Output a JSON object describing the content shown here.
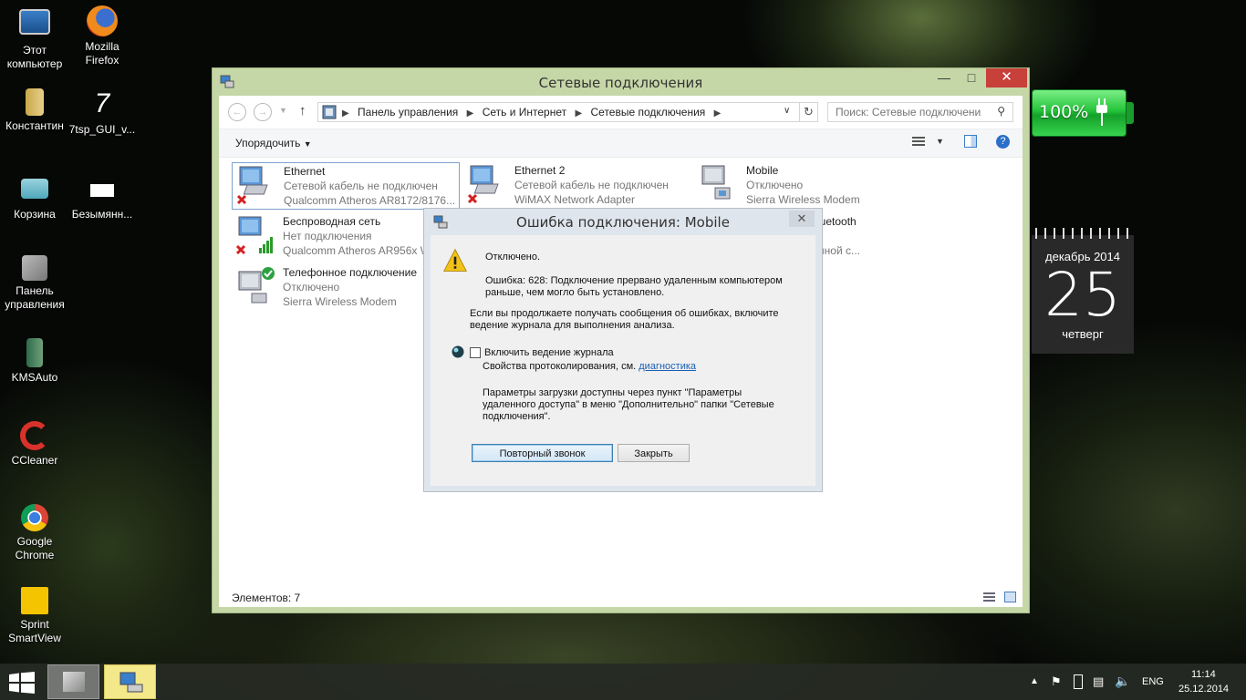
{
  "desktop": {
    "icons": [
      {
        "label": "Этот\nкомпьютер",
        "icon": "computer-icon"
      },
      {
        "label": "Mozilla\nFirefox",
        "icon": "firefox-icon"
      },
      {
        "label": "Константин",
        "icon": "user-folder-icon"
      },
      {
        "label": "7tsp_GUI_v...",
        "icon": "7tsp-icon"
      },
      {
        "label": "Корзина",
        "icon": "recycle-bin-icon"
      },
      {
        "label": "Безымянн...",
        "icon": "image-file-icon"
      },
      {
        "label": "Панель\nуправления",
        "icon": "control-panel-icon"
      },
      {
        "label": "KMSAuto",
        "icon": "kmsauto-icon"
      },
      {
        "label": "CCleaner",
        "icon": "ccleaner-icon"
      },
      {
        "label": "Google\nChrome",
        "icon": "chrome-icon"
      },
      {
        "label": "Sprint\nSmartView",
        "icon": "sprint-icon"
      }
    ]
  },
  "battery_widget": {
    "percent": "100%",
    "level": 1.0,
    "color": "#25c43a"
  },
  "calendar_widget": {
    "month": "декабрь 2014",
    "day": "25",
    "weekday": "четверг"
  },
  "window": {
    "title": "Сетевые подключения",
    "buttons": {
      "minimize": "—",
      "maximize": "□",
      "close": "✕"
    },
    "address": {
      "crumbs": [
        "Панель управления",
        "Сеть и Интернет",
        "Сетевые подключения"
      ]
    },
    "search_placeholder": "Поиск: Сетевые подключения",
    "organize_label": "Упорядочить",
    "items": [
      {
        "name": "Ethernet",
        "status": "Сетевой кабель не подключен",
        "device": "Qualcomm Atheros AR8172/8176...",
        "badge": "red-x",
        "selected": true
      },
      {
        "name": "Ethernet 2",
        "status": "Сетевой кабель не подключен",
        "device": "WiMAX Network Adapter",
        "badge": "red-x",
        "selected": false
      },
      {
        "name": "Mobile",
        "status": "Отключено",
        "device": "Sierra Wireless Modem",
        "badge": "none",
        "selected": false
      },
      {
        "name": "Беспроводная сеть",
        "status": "Нет подключения",
        "device": "Qualcomm Atheros AR956x W",
        "badge": "red-x",
        "selected": false
      },
      {
        "name": "ючение Bluetooth",
        "status": "ия",
        "device": "etooth (личной с...",
        "badge": "none",
        "selected": false
      },
      {
        "name": "Телефонное подключение",
        "status": "Отключено",
        "device": "Sierra Wireless Modem",
        "badge": "green-check",
        "selected": false
      }
    ],
    "status_count": "Элементов: 7"
  },
  "dialog": {
    "title": "Ошибка подключения: Mobile",
    "close": "✕",
    "line_state": "Отключено.",
    "line_error_1": "Ошибка: 628: Подключение прервано удаленным компьютером",
    "line_error_2": "раньше, чем могло быть установлено.",
    "line_advice_1": "Если вы продолжаете получать сообщения об ошибках, включите",
    "line_advice_2": "ведение журнала для выполнения анализа.",
    "checkbox_label": "Включить ведение журнала",
    "checkbox_checked": false,
    "log_props": "Свойства протоколирования, см.",
    "log_link": "диагностика",
    "params_1": "Параметры загрузки доступны через пункт \"Параметры",
    "params_2": "удаленного доступа\" в меню \"Дополнительно\" папки \"Сетевые",
    "params_3": "подключения\".",
    "redial_button": "Повторный звонок",
    "close_button": "Закрыть"
  },
  "taskbar": {
    "language": "ENG",
    "time": "11:14",
    "date": "25.12.2014"
  }
}
